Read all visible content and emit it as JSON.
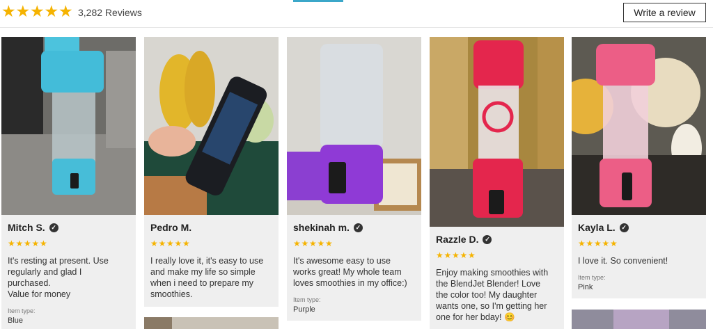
{
  "header": {
    "rating_stars": 5,
    "review_count_label": "3,282 Reviews",
    "write_review_label": "Write a review"
  },
  "colors": {
    "star": "#f5b301",
    "card_bg": "#efefef",
    "accent": "#3ba7c9"
  },
  "reviews": [
    {
      "name": "Mitch S.",
      "verified": true,
      "rating": 5,
      "text": [
        "It's resting at present. Use",
        "regularly and glad I",
        "purchased.",
        "Value for money"
      ],
      "item_type_label": "Item type:",
      "item_type": "Blue",
      "photo": "blue-blender-photo"
    },
    {
      "name": "Pedro M.",
      "verified": false,
      "rating": 5,
      "text": [
        "I really love it, it's easy to use",
        "and make my life so simple",
        "when i need to prepare my",
        "smoothies."
      ],
      "item_type_label": "",
      "item_type": "",
      "photo": "black-blender-photo"
    },
    {
      "name": "shekinah m.",
      "verified": true,
      "rating": 5,
      "text": [
        "It's awesome easy to use",
        "works great! My whole team",
        "loves smoothies in my office:)"
      ],
      "item_type_label": "Item type:",
      "item_type": "Purple",
      "photo": "purple-blender-photo"
    },
    {
      "name": "Razzle D.",
      "verified": true,
      "rating": 5,
      "text": [
        "Enjoy making smoothies with",
        "the BlendJet Blender! Love",
        "the color too! My daughter",
        "wants one, so I'm getting her",
        "one for her bday! 😊"
      ],
      "item_type_label": "",
      "item_type": "",
      "photo": "red-blender-photo"
    },
    {
      "name": "Kayla L.",
      "verified": true,
      "rating": 5,
      "text": [
        "I love it. So convenient!"
      ],
      "item_type_label": "Item type:",
      "item_type": "Pink",
      "photo": "pink-blender-photo"
    }
  ]
}
